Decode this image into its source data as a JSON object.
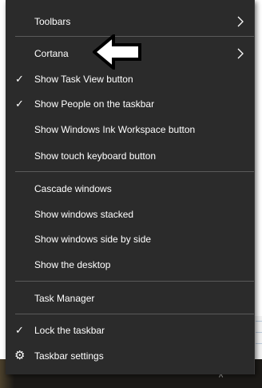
{
  "menu": {
    "groups": [
      [
        {
          "label": "Toolbars",
          "submenu": true
        },
        {
          "label": "Cortana",
          "submenu": true
        },
        {
          "label": "Show Task View button",
          "checked": true
        },
        {
          "label": "Show People on the taskbar",
          "checked": true
        },
        {
          "label": "Show Windows Ink Workspace button",
          "checked": false
        },
        {
          "label": "Show touch keyboard button",
          "checked": false
        }
      ],
      [
        {
          "label": "Cascade windows"
        },
        {
          "label": "Show windows stacked"
        },
        {
          "label": "Show windows side by side"
        },
        {
          "label": "Show the desktop"
        }
      ],
      [
        {
          "label": "Task Manager"
        }
      ],
      [
        {
          "label": "Lock the taskbar",
          "checked": true
        },
        {
          "label": "Taskbar settings",
          "icon": "gear-icon"
        }
      ]
    ],
    "check_glyph": "✓",
    "gear_glyph": "⚙"
  },
  "annotation": {
    "icon": "pointing-arrow-icon",
    "points_to": "Cortana"
  },
  "tray": {
    "caret_glyph": "^"
  },
  "colors": {
    "menu_bg": "#2b2b2b",
    "text": "#ffffff",
    "separator": "#5a5a5a",
    "taskbar": "#1c1a17"
  }
}
